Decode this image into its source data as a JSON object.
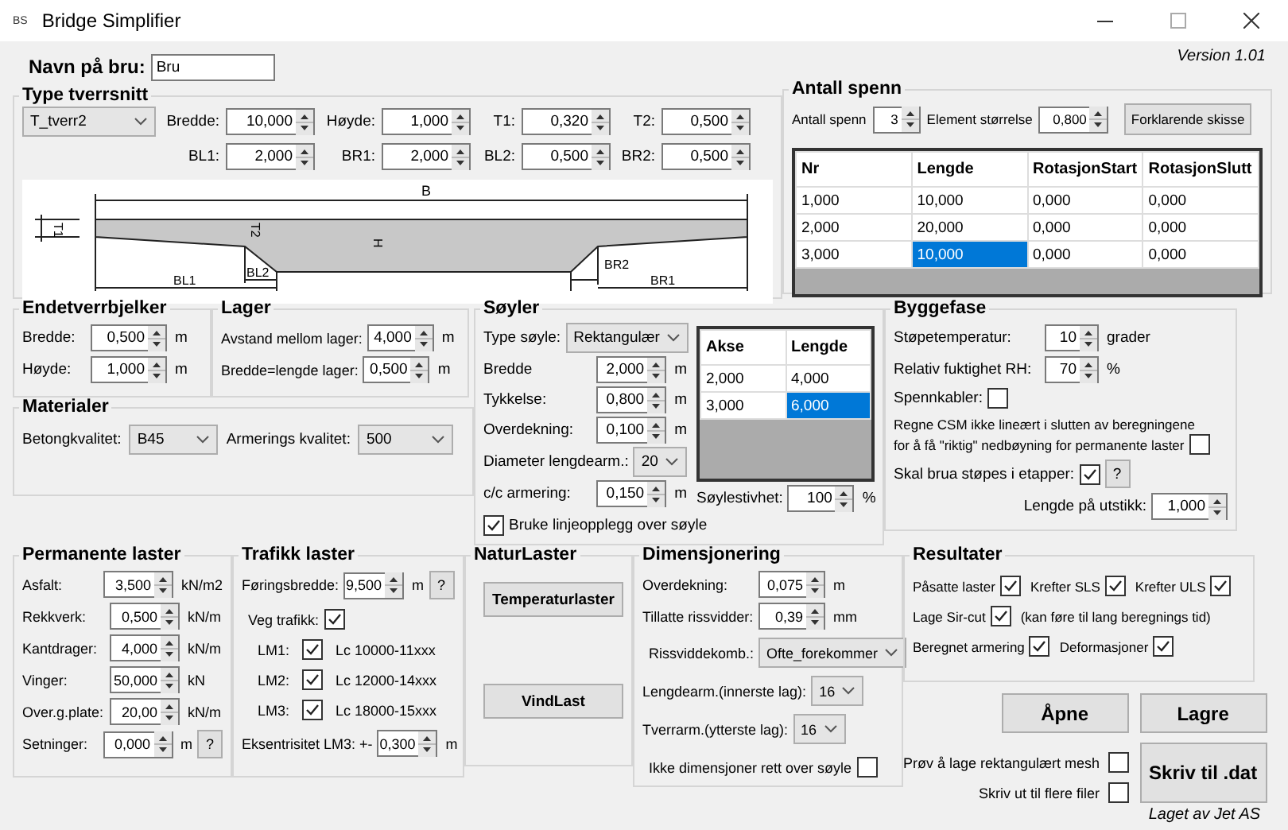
{
  "window": {
    "icon_text": "BS",
    "title": "Bridge Simplifier"
  },
  "version": "Version 1.01",
  "bridge_name": {
    "label": "Navn på bru:",
    "value": "Bru"
  },
  "cross_section": {
    "title": "Type tverrsnitt",
    "type": "T_tverr2",
    "fields": [
      {
        "label": "Bredde:",
        "value": "10,000"
      },
      {
        "label": "Høyde:",
        "value": "1,000"
      },
      {
        "label": "T1:",
        "value": "0,320"
      },
      {
        "label": "T2:",
        "value": "0,500"
      },
      {
        "label": "BL1:",
        "value": "2,000"
      },
      {
        "label": "BR1:",
        "value": "2,000"
      },
      {
        "label": "BL2:",
        "value": "0,500"
      },
      {
        "label": "BR2:",
        "value": "0,500"
      }
    ],
    "diagram_labels": {
      "b": "B",
      "t1": "T1",
      "t2": "T2",
      "h": "H",
      "bl1": "BL1",
      "bl2": "BL2",
      "br2": "BR2",
      "br1": "BR1"
    }
  },
  "spans": {
    "title": "Antall spenn",
    "count_label": "Antall spenn",
    "count": "3",
    "element_label": "Element størrelse",
    "element_size": "0,800",
    "button": "Forklarende skisse",
    "table": {
      "columns": [
        "Nr",
        "Lengde",
        "RotasjonStart",
        "RotasjonSlutt"
      ],
      "rows": [
        {
          "cells": [
            {
              "text": "1,000",
              "selected": false
            },
            {
              "text": "10,000",
              "selected": false
            },
            {
              "text": "0,000",
              "selected": false
            },
            {
              "text": "0,000",
              "selected": false
            }
          ]
        },
        {
          "cells": [
            {
              "text": "2,000",
              "selected": false
            },
            {
              "text": "20,000",
              "selected": false
            },
            {
              "text": "0,000",
              "selected": false
            },
            {
              "text": "0,000",
              "selected": false
            }
          ]
        },
        {
          "cells": [
            {
              "text": "3,000",
              "selected": false
            },
            {
              "text": "10,000",
              "selected": true
            },
            {
              "text": "0,000",
              "selected": false
            },
            {
              "text": "0,000",
              "selected": false
            }
          ]
        }
      ]
    }
  },
  "end_beams": {
    "title": "Endetverrbjelker",
    "fields": [
      {
        "label": "Bredde:",
        "value": "0,500",
        "unit": "m"
      },
      {
        "label": "Høyde:",
        "value": "1,000",
        "unit": "m"
      }
    ]
  },
  "bearings": {
    "title": "Lager",
    "fields": [
      {
        "label": "Avstand mellom lager:",
        "value": "4,000",
        "unit": "m"
      },
      {
        "label": "Bredde=lengde lager:",
        "value": "0,500",
        "unit": "m"
      }
    ]
  },
  "materials": {
    "title": "Materialer",
    "dropdowns": [
      {
        "label": "Betongkvalitet:",
        "value": "B45"
      },
      {
        "label": "Armerings kvalitet:",
        "value": "500"
      }
    ]
  },
  "columns": {
    "title": "Søyler",
    "type_label": "Type søyle:",
    "type": "Rektangulær",
    "fields": [
      {
        "label": "Bredde",
        "value": "2,000",
        "unit": "m"
      },
      {
        "label": "Tykkelse:",
        "value": "0,800",
        "unit": "m"
      },
      {
        "label": "Overdekning:",
        "value": "0,100",
        "unit": "m"
      }
    ],
    "diameter": {
      "label": "Diameter lengdearm.:",
      "value": "20"
    },
    "spacing": {
      "label": "c/c armering:",
      "value": "0,150",
      "unit": "m"
    },
    "line_support": {
      "label": "Bruke linjeopplegg over søyle",
      "checked": true
    },
    "table": {
      "columns": [
        "Akse",
        "Lengde"
      ],
      "rows": [
        {
          "cells": [
            {
              "text": "2,000",
              "selected": false
            },
            {
              "text": "4,000",
              "selected": false
            }
          ]
        },
        {
          "cells": [
            {
              "text": "3,000",
              "selected": false
            },
            {
              "text": "6,000",
              "selected": true
            }
          ]
        }
      ]
    },
    "stiffness": {
      "label": "Søylestivhet:",
      "value": "100",
      "unit": "%"
    }
  },
  "construction_phase": {
    "title": "Byggefase",
    "temperature": {
      "label": "Støpetemperatur:",
      "value": "10",
      "unit": "grader"
    },
    "humidity": {
      "label": "Relativ fuktighet RH:",
      "value": "70",
      "unit": "%"
    },
    "tendons": {
      "label": "Spennkabler:",
      "checked": false
    },
    "csm": {
      "lines": [
        "Regne CSM ikke lineært i slutten av beregningene",
        "for å få \"riktig\" nedbøyning for permanente laster"
      ],
      "checked": false
    },
    "stages": {
      "label": "Skal brua støpes i etapper:",
      "checked": true,
      "help": "?"
    },
    "overhang": {
      "label": "Lengde på utstikk:",
      "value": "1,000"
    }
  },
  "permanent_loads": {
    "title": "Permanente laster",
    "fields": [
      {
        "label": "Asfalt:",
        "value": "3,500",
        "unit": "kN/m2"
      },
      {
        "label": "Rekkverk:",
        "value": "0,500",
        "unit": "kN/m"
      },
      {
        "label": "Kantdrager:",
        "value": "4,000",
        "unit": "kN/m"
      },
      {
        "label": "Vinger:",
        "value": "50,000",
        "unit": "kN"
      },
      {
        "label": "Over.g.plate:",
        "value": "20,00",
        "unit": "kN/m"
      },
      {
        "label": "Setninger:",
        "value": "0,000",
        "unit": "m",
        "help": "?"
      }
    ]
  },
  "traffic_loads": {
    "title": "Trafikk laster",
    "lane_width": {
      "label": "Føringsbredde:",
      "value": "9,500",
      "unit": "m",
      "help": "?"
    },
    "road_traffic": {
      "label": "Veg trafikk:",
      "checked": true
    },
    "load_models": [
      {
        "label": "LM1:",
        "checked": true,
        "text": "Lc 10000-11xxx"
      },
      {
        "label": "LM2:",
        "checked": true,
        "text": "Lc 12000-14xxx"
      },
      {
        "label": "LM3:",
        "checked": true,
        "text": "Lc 18000-15xxx"
      }
    ],
    "eccentricity": {
      "label": "Eksentrisitet LM3: +-",
      "value": "0,300",
      "unit": "m"
    }
  },
  "natural_loads": {
    "title": "NaturLaster",
    "buttons": [
      "Temperaturlaster",
      "VindLast"
    ]
  },
  "design": {
    "title": "Dimensjonering",
    "fields": [
      {
        "label": "Overdekning:",
        "value": "0,075",
        "unit": "m"
      },
      {
        "label": "Tillatte rissvidder:",
        "value": "0,39",
        "unit": "mm"
      }
    ],
    "dropdowns": [
      {
        "label": "Rissviddekomb.:",
        "value": "Ofte_forekommer"
      },
      {
        "label": "Lengdearm.(innerste lag):",
        "value": "16"
      },
      {
        "label": "Tverrarm.(ytterste lag):",
        "value": "16"
      }
    ],
    "skip_over_column": {
      "label": "Ikke dimensjoner rett over søyle",
      "checked": false
    }
  },
  "results": {
    "title": "Resultater",
    "rows": [
      {
        "items": [
          {
            "kind": "check",
            "label": "Påsatte laster",
            "checked": true
          },
          {
            "kind": "check",
            "label": "Krefter SLS",
            "checked": true
          },
          {
            "kind": "check",
            "label": "Krefter ULS",
            "checked": true
          }
        ]
      },
      {
        "items": [
          {
            "kind": "check",
            "label": "Lage Sir-cut",
            "checked": true
          },
          {
            "kind": "note",
            "label": "(kan føre til lang beregnings tid)"
          }
        ]
      },
      {
        "items": [
          {
            "kind": "check",
            "label": "Beregnet armering",
            "checked": true
          },
          {
            "kind": "check",
            "label": "Deformasjoner",
            "checked": true
          }
        ]
      }
    ]
  },
  "actions": {
    "open": "Åpne",
    "save": "Lagre",
    "write": "Skriv til .dat",
    "options": [
      {
        "label": "Prøv å lage rektangulært mesh",
        "checked": false
      },
      {
        "label": "Skriv ut til flere filer",
        "checked": false
      }
    ]
  },
  "footer": "Laget av Jet AS"
}
